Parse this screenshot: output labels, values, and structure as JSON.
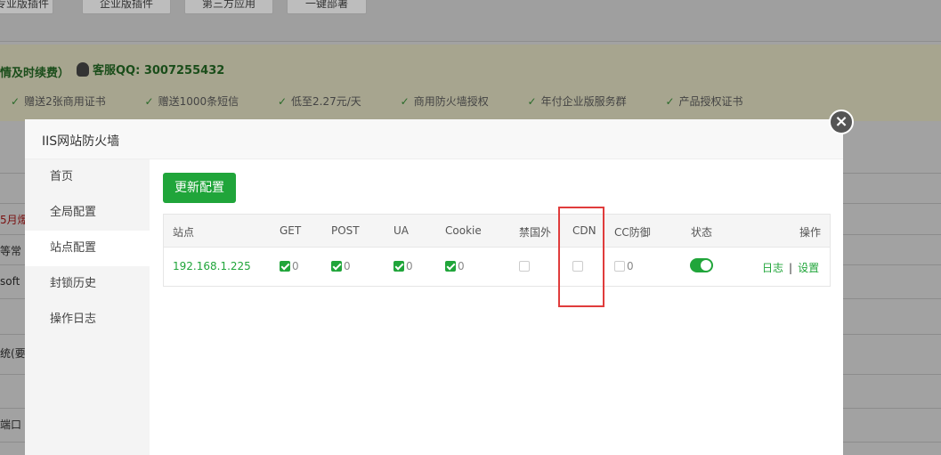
{
  "background": {
    "top_buttons": [
      "专业版插件",
      "企业版插件",
      "第三方应用",
      "一键部署"
    ],
    "banner_left": "情及时续费）",
    "qq_label": "客服QQ: 3007255432",
    "perks": [
      "赠送2张商用证书",
      "赠送1000条短信",
      "低至2.27元/天",
      "商用防火墙授权",
      "年付企业版服务群",
      "产品授权证书"
    ],
    "left_texts": [
      "5月爆",
      "等常",
      "soft",
      "统(要",
      "端口"
    ]
  },
  "modal": {
    "title": "IIS网站防火墙",
    "nav": [
      {
        "label": "首页",
        "active": false
      },
      {
        "label": "全局配置",
        "active": false
      },
      {
        "label": "站点配置",
        "active": true
      },
      {
        "label": "封锁历史",
        "active": false
      },
      {
        "label": "操作日志",
        "active": false
      }
    ],
    "update_button": "更新配置",
    "table": {
      "headers": [
        "站点",
        "GET",
        "POST",
        "UA",
        "Cookie",
        "禁国外",
        "CDN",
        "CC防御",
        "状态",
        "操作"
      ],
      "row": {
        "site": "192.168.1.225",
        "get": {
          "checked": true,
          "count": "0"
        },
        "post": {
          "checked": true,
          "count": "0"
        },
        "ua": {
          "checked": true,
          "count": "0"
        },
        "cookie": {
          "checked": true,
          "count": "0"
        },
        "foreign": {
          "checked": false
        },
        "cdn": {
          "checked": false
        },
        "cc": {
          "checked": false,
          "count": "0"
        },
        "status_on": true,
        "op_log": "日志",
        "op_sep": "|",
        "op_settings": "设置"
      }
    }
  },
  "colors": {
    "accent": "#20a53a",
    "highlight": "#e03c3c"
  }
}
